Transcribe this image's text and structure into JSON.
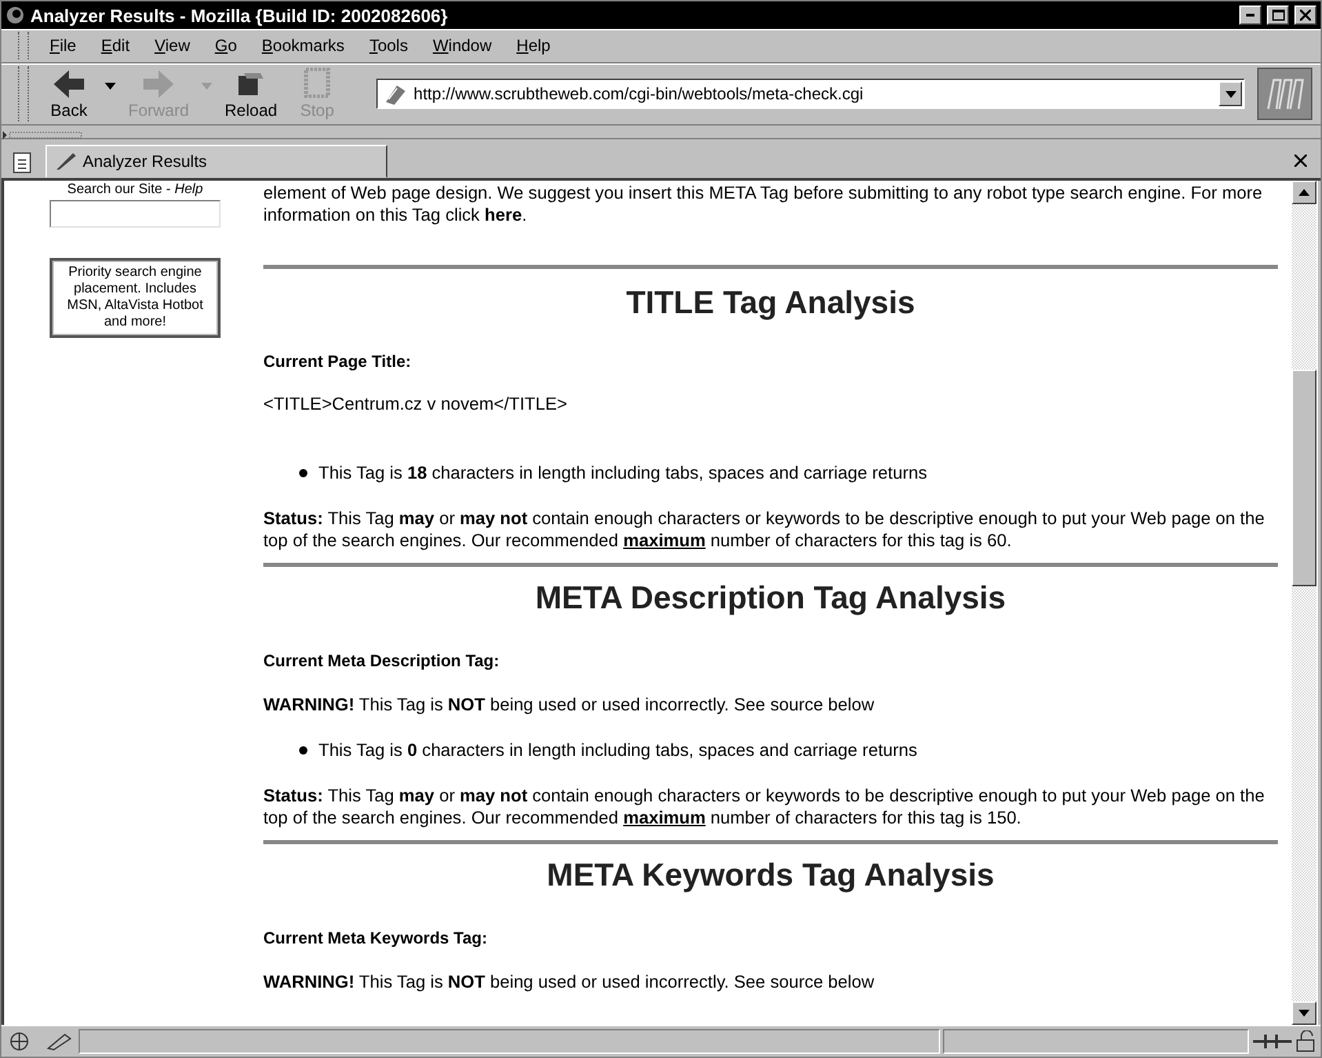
{
  "window": {
    "title": "Analyzer Results - Mozilla {Build ID: 2002082606}"
  },
  "menu": [
    "File",
    "Edit",
    "View",
    "Go",
    "Bookmarks",
    "Tools",
    "Window",
    "Help"
  ],
  "toolbar": [
    {
      "label": "Back",
      "kind": "back",
      "disabled": false,
      "dropdown": true
    },
    {
      "label": "Forward",
      "kind": "forward",
      "disabled": true,
      "dropdown": true
    },
    {
      "label": "Reload",
      "kind": "reload",
      "disabled": false,
      "dropdown": false
    },
    {
      "label": "Stop",
      "kind": "stop",
      "disabled": true,
      "dropdown": false
    }
  ],
  "address": {
    "value": "http://www.scrubtheweb.com/cgi-bin/webtools/meta-check.cgi"
  },
  "tabs": [
    {
      "label": "Analyzer Results",
      "selected": true
    }
  ],
  "sidebar": {
    "search_label": "Search our Site - *Help*",
    "ad": "Priority search engine placement. Includes MSN, AltaVista Hotbot and more!"
  },
  "intro": {
    "text": "element of Web page design. We suggest you insert this META Tag before submitting to any robot type search engine. For more information on this Tag click",
    "link": "here",
    "after": "."
  },
  "sections": [
    {
      "title": "TITLE Tag Analysis",
      "label": "Current Page Title:",
      "tag_text": "<TITLE>Centrum.cz v novem</TITLE>",
      "bullet": "This Tag is **18** characters in length including tabs, spaces and carriage returns",
      "status": {
        "before": "**Status:** This Tag **may** or **may not** contain enough characters or keywords to be descriptive enough to put your Web page on the top of the search engines. Our recommended",
        "link": "maximum",
        "after": "number of characters for this tag is 60."
      }
    },
    {
      "title": "META Description Tag Analysis",
      "label": "Current Meta Description Tag:",
      "warning": "**WARNING!** This Tag is **NOT** being used or used incorrectly. See source below",
      "bullet": "This Tag is **0** characters in length including tabs, spaces and carriage returns",
      "status": {
        "before": "**Status:** This Tag **may** or **may not** contain enough characters or keywords to be descriptive enough to put your Web page on the top of the search engines. Our recommended",
        "link": "maximum",
        "after": "number of characters for this tag is 150."
      }
    },
    {
      "title": "META Keywords Tag Analysis",
      "label": "Current Meta Keywords Tag:",
      "warning": "**WARNING!** This Tag is **NOT** being used or used incorrectly. See source below"
    }
  ]
}
